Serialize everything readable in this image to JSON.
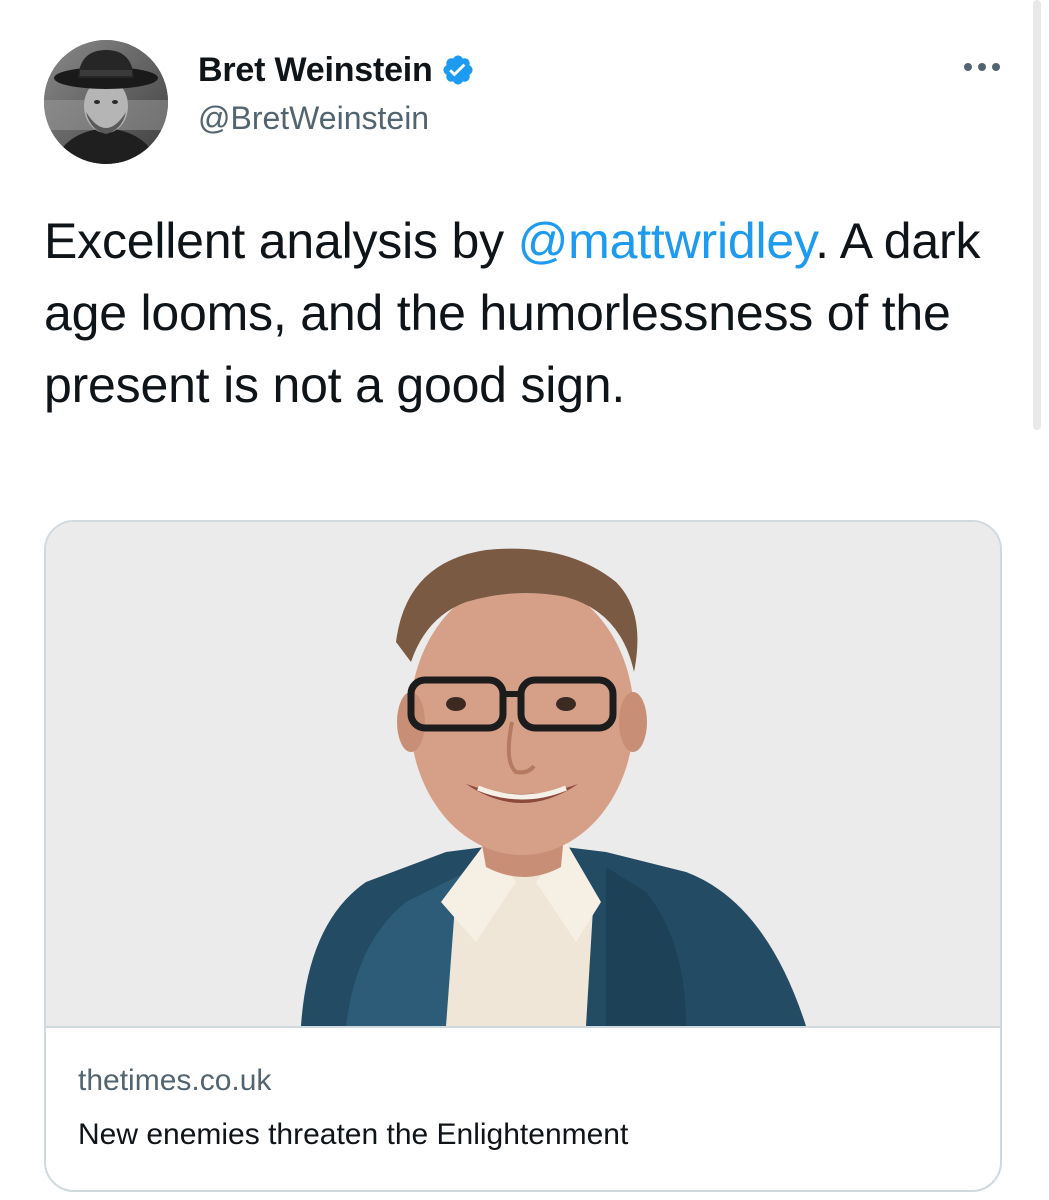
{
  "author": {
    "display_name": "Bret Weinstein",
    "handle": "@BretWeinstein",
    "verified": true,
    "avatar_icon": "profile-photo"
  },
  "tweet": {
    "text_before": "Excellent analysis by ",
    "mention": "@mattwridley",
    "text_after": ". A dark age looms, and the humorlessness of the present is not a good sign."
  },
  "card": {
    "domain": "thetimes.co.uk",
    "title": "New enemies threaten the Enlightenment",
    "image_icon": "author-portrait-photo"
  },
  "menu": {
    "icon": "more-options-icon"
  },
  "colors": {
    "link": "#1d9bf0",
    "secondary_text": "#536471",
    "border": "#cfd9de",
    "verified_badge": "#1d9bf0"
  }
}
